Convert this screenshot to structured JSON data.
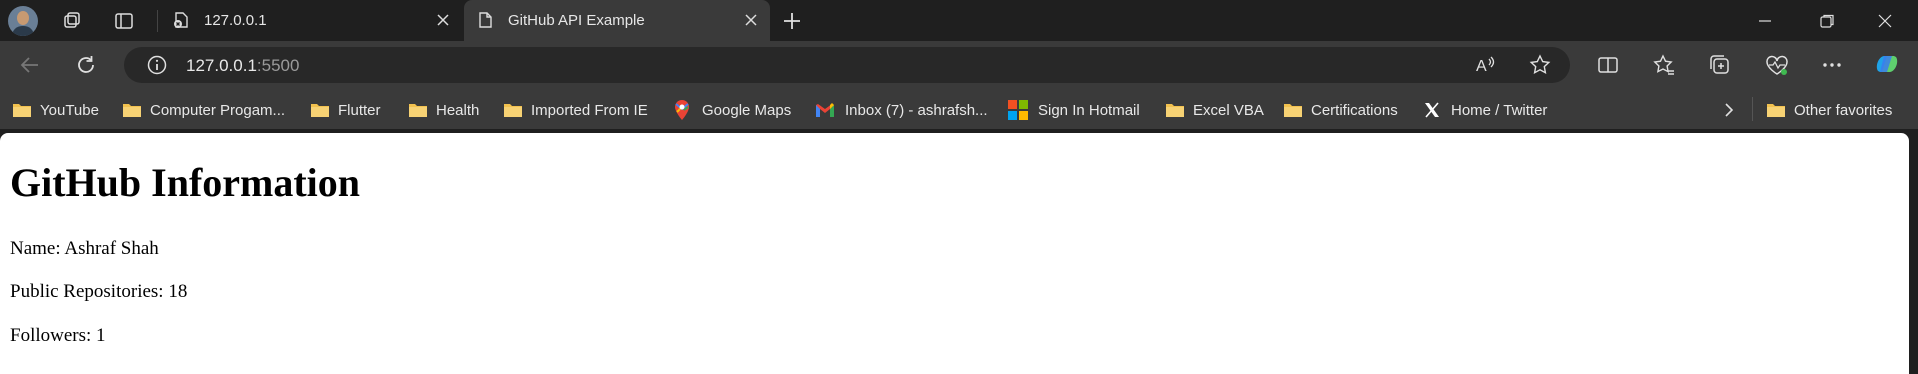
{
  "tabs": [
    {
      "title": "127.0.0.1",
      "active": false
    },
    {
      "title": "GitHub API Example",
      "active": true
    }
  ],
  "address": {
    "host": "127.0.0.1",
    "port": ":5500"
  },
  "bookmarks": [
    {
      "label": "YouTube",
      "icon": "folder-icon"
    },
    {
      "label": "Computer Progam...",
      "icon": "folder-icon"
    },
    {
      "label": "Flutter",
      "icon": "folder-icon"
    },
    {
      "label": "Health",
      "icon": "folder-icon"
    },
    {
      "label": "Imported From IE",
      "icon": "folder-icon"
    },
    {
      "label": "Google Maps",
      "icon": "google-maps-icon"
    },
    {
      "label": "Inbox (7) - ashrafsh...",
      "icon": "gmail-icon"
    },
    {
      "label": "Sign In Hotmail",
      "icon": "microsoft-icon"
    },
    {
      "label": "Excel VBA",
      "icon": "folder-icon"
    },
    {
      "label": "Certifications",
      "icon": "folder-icon"
    },
    {
      "label": "Home / Twitter",
      "icon": "x-icon"
    }
  ],
  "other_favorites": "Other favorites",
  "page": {
    "heading": "GitHub Information",
    "name_line": "Name: Ashraf Shah",
    "repos_line": "Public Repositories: 18",
    "followers_line": "Followers: 1"
  },
  "colors": {
    "folder": "#f2c14e",
    "content_bg": "#ffffff",
    "chrome_bg": "#3a3a3a"
  }
}
